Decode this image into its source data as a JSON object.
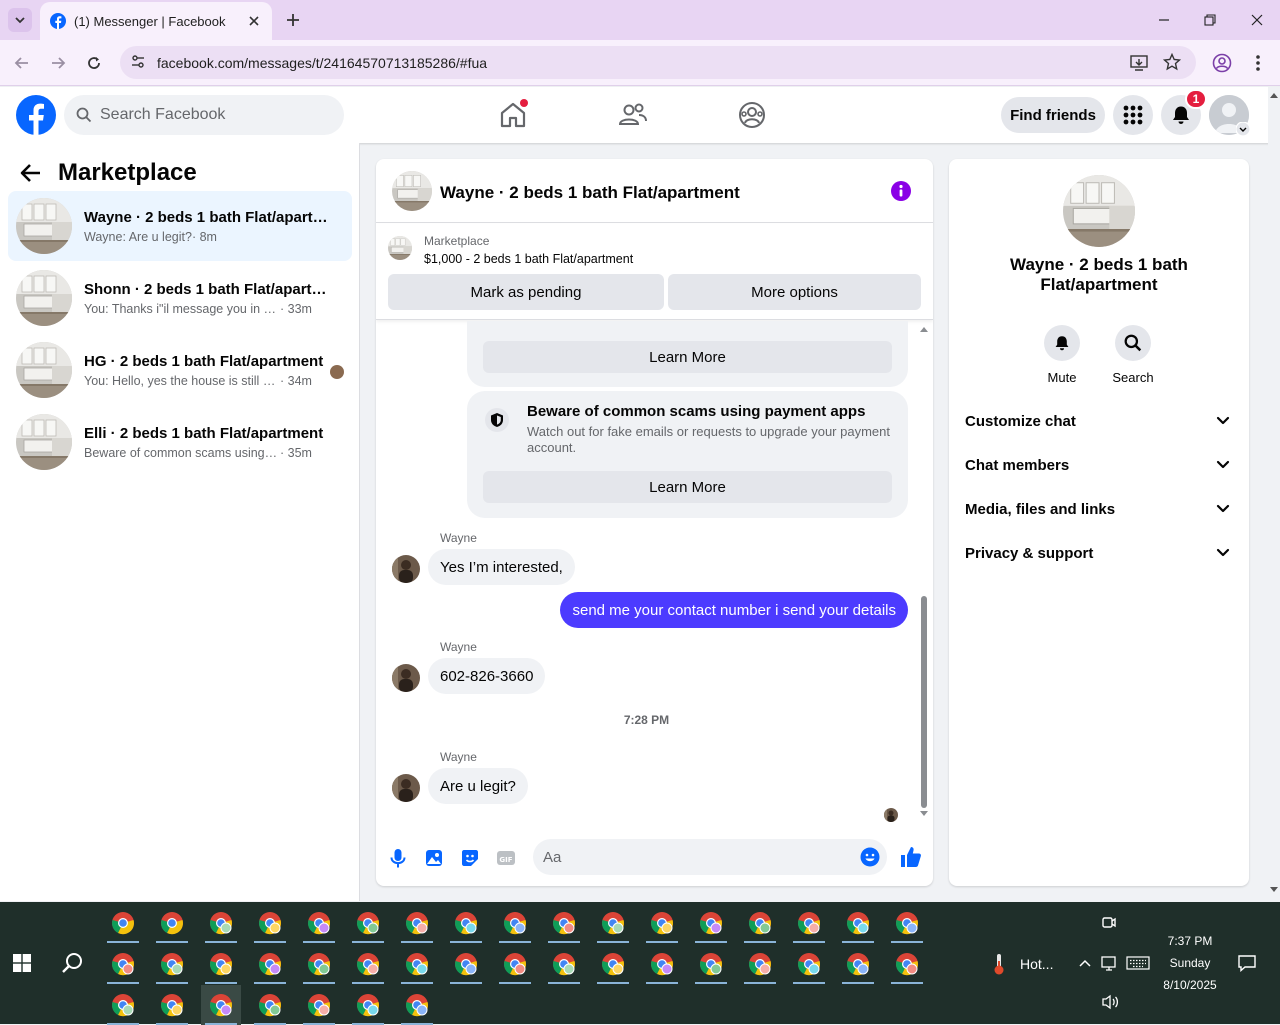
{
  "browser": {
    "tab_title": "(1) Messenger | Facebook",
    "url": "facebook.com/messages/t/24164570713185286/#fua"
  },
  "fb_header": {
    "search_placeholder": "Search Facebook",
    "find_friends": "Find friends",
    "notification_count": "1"
  },
  "sidebar": {
    "title": "Marketplace",
    "conversations": [
      {
        "name": "Wayne · 2 beds 1 bath Flat/apartm...",
        "message": "Wayne: Are u legit?",
        "time": "· 8m",
        "active": true
      },
      {
        "name": "Shonn · 2 beds 1 bath Flat/apartm...",
        "message": "You: Thanks i\"il message you in a m...",
        "time": "· 33m",
        "active": false
      },
      {
        "name": "HG · 2 beds 1 bath Flat/apartment",
        "message": "You: Hello, yes the house is still a...",
        "time": "· 34m",
        "active": false
      },
      {
        "name": "Elli · 2 beds 1 bath Flat/apartment",
        "message": "Beware of common scams using pa...",
        "time": "· 35m",
        "active": false
      }
    ]
  },
  "chat": {
    "title": "Wayne · 2 beds 1 bath Flat/apartment",
    "marketplace_label": "Marketplace",
    "listing": "$1,000 - 2 beds 1 bath Flat/apartment",
    "mark_pending": "Mark as pending",
    "more_options": "More options",
    "learn_more": "Learn More",
    "scam_title": "Beware of common scams using payment apps",
    "scam_body_1": "Watch out for fake emails or requests to upgrade your payment",
    "scam_body_2": "account.",
    "messages": [
      {
        "sender": "Wayne",
        "text": "Yes I’m interested,"
      },
      {
        "sender": "",
        "text": "send me your contact number i send your details"
      },
      {
        "sender": "Wayne",
        "text": "602-826-3660"
      },
      {
        "sender": "Wayne",
        "text": "Are u legit?"
      }
    ],
    "timestamp": "7:28 PM",
    "composer_placeholder": "Aa"
  },
  "info_panel": {
    "name_line1": "Wayne · 2 beds 1 bath",
    "name_line2": "Flat/apartment",
    "mute": "Mute",
    "search": "Search",
    "sections": [
      "Customize chat",
      "Chat members",
      "Media, files and links",
      "Privacy & support"
    ]
  },
  "taskbar": {
    "weather": "Hot...",
    "time": "7:37 PM",
    "day": "Sunday",
    "date": "8/10/2025"
  },
  "colors": {
    "fb_blue": "#0866ff",
    "outgoing_bubble": "#4c3bff",
    "info_icon": "#8a00e6",
    "browser_frame": "#e8d5f3",
    "taskbar": "#1f2f2a"
  }
}
